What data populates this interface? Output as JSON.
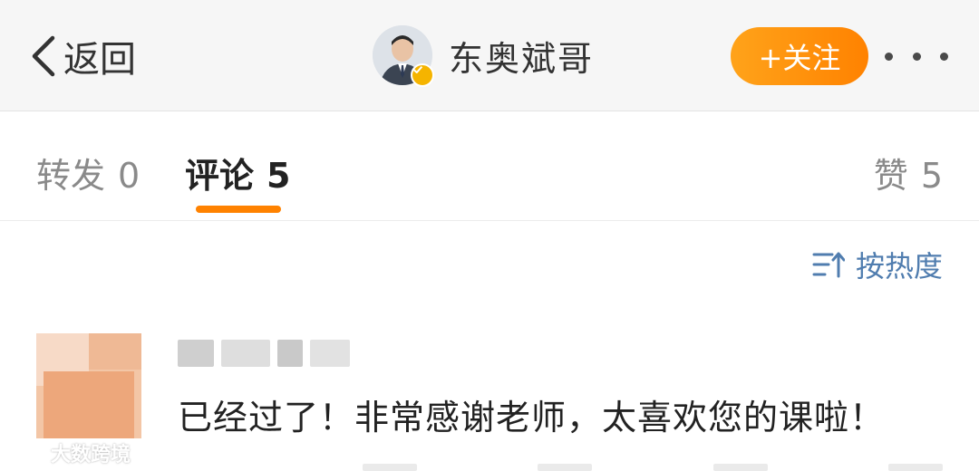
{
  "header": {
    "back_label": "返回",
    "username": "东奥斌哥",
    "follow_label": "+关注",
    "icons": [
      "chevron-left-icon",
      "verified-badge-icon",
      "more-icon"
    ],
    "colors": {
      "follow_gradient_start": "#ffa31a",
      "follow_gradient_end": "#ff8200",
      "verified": "#f5b400"
    }
  },
  "tabs": {
    "repost": {
      "label": "转发",
      "count": "0"
    },
    "comment": {
      "label": "评论",
      "count": "5"
    },
    "like": {
      "label": "赞",
      "count": "5"
    },
    "active": "comment",
    "active_color": "#ff8200"
  },
  "sort": {
    "label": "按热度",
    "icon": "sort-icon",
    "color": "#507daf"
  },
  "comments": [
    {
      "text": "已经过了！非常感谢老师，太喜欢您的课啦！"
    }
  ],
  "watermark": {
    "text": "大数跨境"
  }
}
